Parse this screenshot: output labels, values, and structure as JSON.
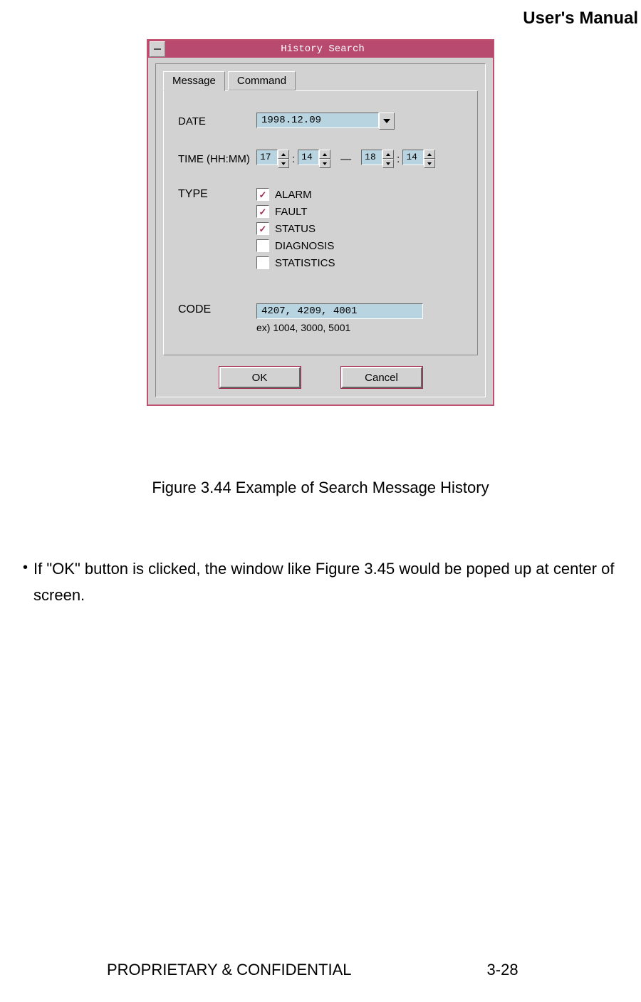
{
  "header": {
    "title": "User's Manual"
  },
  "dialog": {
    "title": "History Search",
    "tabs": {
      "message": "Message",
      "command": "Command"
    },
    "labels": {
      "date": "DATE",
      "time": "TIME (HH:MM)",
      "type": "TYPE",
      "code": "CODE"
    },
    "date_value": "1998.12.09",
    "time": {
      "from_h": "17",
      "from_m": "14",
      "to_h": "18",
      "to_m": "14",
      "separator": "—",
      "colon": ":"
    },
    "types": [
      {
        "label": "ALARM",
        "checked": true
      },
      {
        "label": "FAULT",
        "checked": true
      },
      {
        "label": "STATUS",
        "checked": true
      },
      {
        "label": "DIAGNOSIS",
        "checked": false
      },
      {
        "label": "STATISTICS",
        "checked": false
      }
    ],
    "code_value": "4207, 4209, 4001",
    "code_hint": "ex) 1004, 3000, 5001",
    "buttons": {
      "ok": "OK",
      "cancel": "Cancel"
    }
  },
  "figure_caption": "Figure 3.44 Example of Search Message History",
  "body_para": "If \"OK\" button is clicked, the window like Figure 3.45 would be poped up at center of screen.",
  "footer": {
    "left": "PROPRIETARY & CONFIDENTIAL",
    "right": "3-28"
  }
}
